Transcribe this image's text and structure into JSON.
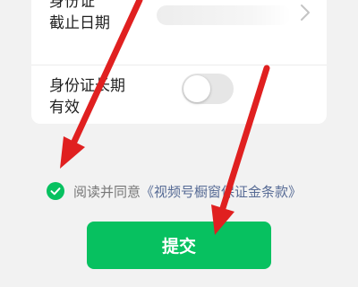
{
  "form": {
    "id_expiry_label_line1": "身份证",
    "id_expiry_label_line2": "截止日期",
    "id_longterm_label_line1": "身份证长期",
    "id_longterm_label_line2": "有效",
    "id_longterm_toggle": "off"
  },
  "agreement": {
    "checked": true,
    "text": "阅读并同意",
    "link": "《视频号橱窗保证金条款》"
  },
  "submit": {
    "label": "提交"
  },
  "colors": {
    "accent": "#07c160",
    "annotation_arrow": "#e02020",
    "link": "#576b95"
  },
  "icons": [
    "chevron-right-icon",
    "check-circle-icon"
  ]
}
